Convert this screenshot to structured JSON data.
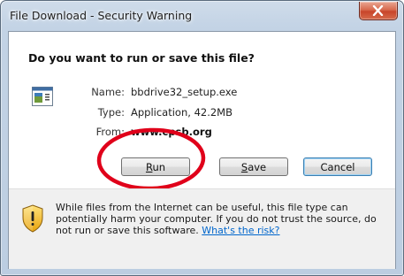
{
  "window": {
    "title": "File Download - Security Warning"
  },
  "dialog": {
    "question": "Do you want to run or save this file?",
    "file": {
      "name_label": "Name:",
      "name_value": "bbdrive32_setup.exe",
      "type_label": "Type:",
      "type_value": "Application, 42.2MB",
      "from_label": "From:",
      "from_value": "www.cpsb.org"
    },
    "buttons": {
      "run_mnemonic": "R",
      "run_rest": "un",
      "save_mnemonic": "S",
      "save_rest": "ave",
      "cancel": "Cancel"
    },
    "warning": {
      "text": "While files from the Internet can be useful, this file type can potentially harm your computer. If you do not trust the source, do not run or save this software. ",
      "link": "What's the risk?"
    }
  },
  "colors": {
    "annotation": "#e0001a",
    "link": "#0066cc",
    "close_button": "#c8452a"
  },
  "icons": [
    "close-icon",
    "application-file-icon",
    "security-shield-icon"
  ]
}
